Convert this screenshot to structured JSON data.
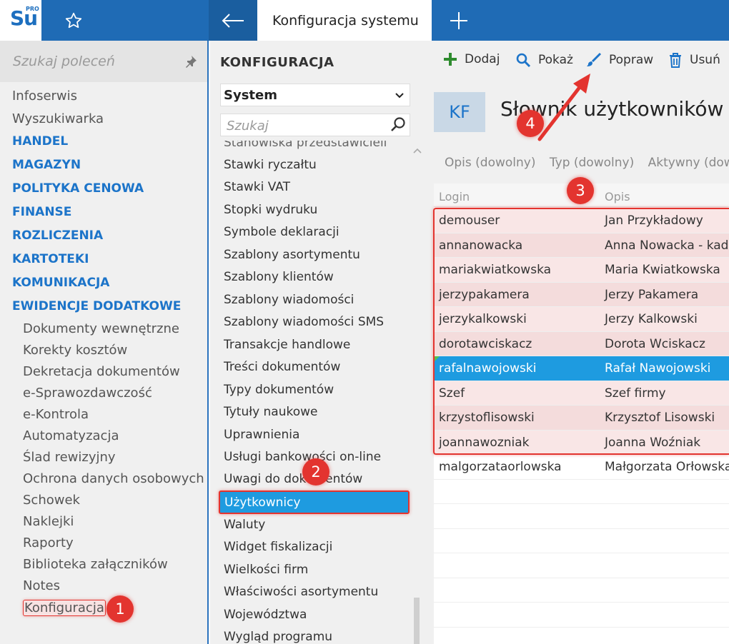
{
  "app": {
    "logo_text": "Su",
    "logo_badge": "PRO",
    "active_tab": "Konfiguracja systemu"
  },
  "sidebar": {
    "search_placeholder": "Szukaj poleceń",
    "top_items": [
      "Infoserwis",
      "Wyszukiwarka"
    ],
    "sections": [
      "HANDEL",
      "MAGAZYN",
      "POLITYKA CENOWA",
      "FINANSE",
      "ROZLICZENIA",
      "KARTOTEKI",
      "KOMUNIKACJA",
      "EWIDENCJE DODATKOWE"
    ],
    "sub_items": [
      "Dokumenty wewnętrzne",
      "Korekty kosztów",
      "Dekretacja dokumentów",
      "e-Sprawozdawczość",
      "e-Kontrola",
      "Automatyzacja",
      "Ślad rewizyjny",
      "Ochrona danych osobowych",
      "Schowek",
      "Naklejki",
      "Raporty",
      "Biblioteka załączników",
      "Notes",
      "Konfiguracja"
    ]
  },
  "config_panel": {
    "title": "KONFIGURACJA",
    "selected_area": "System",
    "search_placeholder": "Szukaj",
    "partial_top_item": "Stanowiska przedstawicieli",
    "items": [
      "Stawki ryczałtu",
      "Stawki VAT",
      "Stopki wydruku",
      "Symbole deklaracji",
      "Szablony asortymentu",
      "Szablony klientów",
      "Szablony wiadomości",
      "Szablony wiadomości SMS",
      "Transakcje handlowe",
      "Treści dokumentów",
      "Typy dokumentów",
      "Tytuły naukowe",
      "Uprawnienia",
      "Usługi bankowości on-line",
      "Uwagi do dokumentów",
      "Użytkownicy",
      "Waluty",
      "Widget fiskalizacji",
      "Wielkości firm",
      "Właściwości asortymentu",
      "Województwa",
      "Wygląd programu"
    ],
    "selected_item": "Użytkownicy"
  },
  "toolbar": {
    "add": "Dodaj",
    "show": "Pokaż",
    "edit": "Popraw",
    "delete": "Usuń"
  },
  "dictionary": {
    "badge": "KF",
    "title": "Słownik użytkowników",
    "filters": [
      "Opis (dowolny)",
      "Typ (dowolny)",
      "Aktywny (dowoln"
    ],
    "columns": [
      "Login",
      "Opis"
    ],
    "rows": [
      {
        "login": "demouser",
        "opis": "Jan Przykładowy"
      },
      {
        "login": "annanowacka",
        "opis": "Anna Nowacka - kadro"
      },
      {
        "login": "mariakwiatkowska",
        "opis": "Maria Kwiatkowska"
      },
      {
        "login": "jerzypakamera",
        "opis": "Jerzy Pakamera"
      },
      {
        "login": "jerzykalkowski",
        "opis": "Jerzy Kalkowski"
      },
      {
        "login": "dorotawciskacz",
        "opis": "Dorota Wciskacz"
      },
      {
        "login": "rafalnawojowski",
        "opis": "Rafał Nawojowski"
      },
      {
        "login": "Szef",
        "opis": "Szef firmy"
      },
      {
        "login": "krzystoflisowski",
        "opis": "Krzysztof Lisowski"
      },
      {
        "login": "joannawozniak",
        "opis": "Joanna Woźniak"
      },
      {
        "login": "malgorzataorlowska",
        "opis": "Małgorzata Orłowska"
      }
    ],
    "selected_login": "rafalnawojowski"
  },
  "annotations": [
    "1",
    "2",
    "3",
    "4"
  ],
  "colors": {
    "brand_blue": "#1f6bb5",
    "selection_blue": "#1e9be0",
    "annotation_red": "#e3342f",
    "section_blue": "#1c74c9"
  }
}
